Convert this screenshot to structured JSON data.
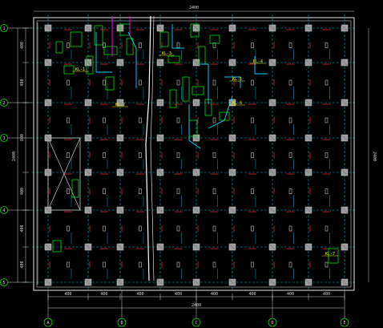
{
  "drawing": {
    "grid_x": [
      60,
      110,
      150,
      200,
      245,
      290,
      340,
      385,
      430
    ],
    "grid_y": [
      35,
      78,
      128,
      172,
      215,
      262,
      308,
      352
    ],
    "bubble_cols": [
      "A",
      "B",
      "C",
      "D",
      "E"
    ],
    "bubble_rows": [
      "1",
      "2",
      "3",
      "4",
      "5"
    ],
    "dim_top": "2400",
    "dims_bottom": [
      "400",
      "400",
      "400",
      "400",
      "400",
      "400",
      "400",
      "400",
      "400"
    ],
    "dim_bottom_total": "2400",
    "dims_left": [
      "400",
      "400",
      "800",
      "400",
      "400",
      "400"
    ],
    "dim_left_total": "2400",
    "dim_right_total": "2400",
    "note_labels": [
      "KL-1",
      "KL-2",
      "KL-3",
      "KL-4",
      "KL-5",
      "KL-6",
      "KL-7"
    ],
    "colors": {
      "background": "#000000",
      "outline": "#e6e6e6",
      "grid_cyan": "#00d8ff",
      "column_grey": "#9a9a9a",
      "red_ticks": "#ff3030",
      "green_detail": "#00e000",
      "yellow_notes": "#f2f200",
      "magenta": "#ff00ff",
      "white_lines": "#ffffff"
    }
  }
}
